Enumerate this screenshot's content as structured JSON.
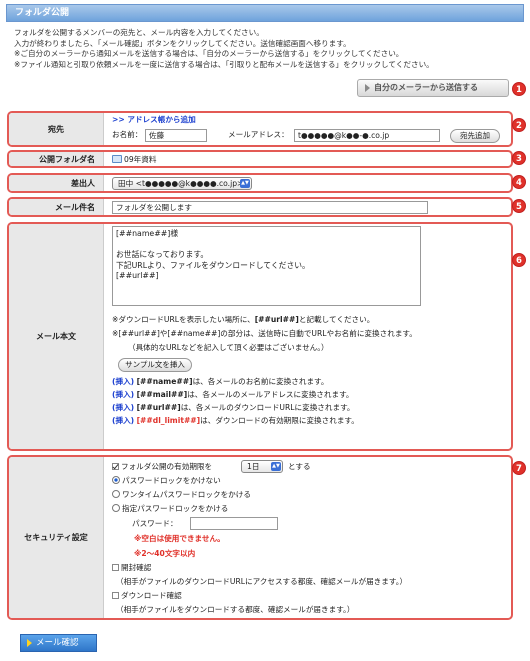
{
  "header": {
    "title": "フォルダ公開"
  },
  "intro": [
    "フォルダを公開するメンバーの宛先と、メール内容を入力してください。",
    "入力が終わりましたら、「メール確認」ボタンをクリックしてください。送信確認画面へ移ります。",
    "※ご自分のメーラーから通知メールを送信する場合は、「自分のメーラーから送信する」をクリックしてください。",
    "※ファイル通知と引取り依頼メールを一度に送信する場合は、「引取りと配布メールを送信する」をクリックしてください。"
  ],
  "own_mailer_button": "自分のメーラーから送信する",
  "badges": [
    "1",
    "2",
    "3",
    "4",
    "5",
    "6",
    "7"
  ],
  "recipient": {
    "label": "宛先",
    "address_book_link": ">> アドレス帳から追加",
    "name_label": "お名前：",
    "name_value": "佐藤",
    "email_label": "メールアドレス：",
    "email_value": "t●●●●●@k●●-●.co.jp",
    "add_button": "宛先追加"
  },
  "folder": {
    "label": "公開フォルダ名",
    "value": "09年資料"
  },
  "sender": {
    "label": "差出人",
    "value": "田中 <t●●●●●@k●●●●.co.jp>"
  },
  "subject": {
    "label": "メール件名",
    "value": "フォルダを公開します"
  },
  "body": {
    "label": "メール本文",
    "text": "[##name##]様\n\nお世話になっております。\n下記URLより、ファイルをダウンロードしてください。\n[##url##]",
    "note1_pre": "※ダウンロードURLを表示したい場所に、",
    "note1_tag": "[##url##]",
    "note1_post": "と記載してください。",
    "note2": "※[##url##]や[##name##]の部分は、送信時に自動でURLやお名前に変換されます。",
    "note3": "（具体的なURLなどを記入して頂く必要はございません。）",
    "sample_button": "サンプル文を挿入",
    "inserts": [
      {
        "link": "(挿入)",
        "tag": "[##name##]",
        "desc": "は、各メールのお名前に変換されます。",
        "red": false
      },
      {
        "link": "(挿入)",
        "tag": "[##mail##]",
        "desc": "は、各メールのメールアドレスに変換されます。",
        "red": false
      },
      {
        "link": "(挿入)",
        "tag": "[##url##]",
        "desc": "は、各メールのダウンロードURLに変換されます。",
        "red": false
      },
      {
        "link": "(挿入)",
        "tag": "[##dl_limit##]",
        "desc": "は、ダウンロードの有効期限に変換されます。",
        "red": true
      }
    ]
  },
  "security": {
    "label": "セキュリティ設定",
    "expiry_pre": "フォルダ公開の有効期限を",
    "expiry_value": "1日",
    "expiry_post": "とする",
    "opt_none": "パスワードロックをかけない",
    "opt_onetime": "ワンタイムパスワードロックをかける",
    "opt_fixed": "指定パスワードロックをかける",
    "password_label": "パスワード：",
    "password_value": "",
    "warn1": "※空白は使用できません。",
    "warn2": "※2～40文字以内",
    "open_confirm": "開封確認",
    "open_confirm_note": "（相手がファイルのダウンロードURLにアクセスする都度、確認メールが届きます。）",
    "dl_confirm": "ダウンロード確認",
    "dl_confirm_note": "（相手がファイルをダウンロードする都度、確認メールが届きます。）"
  },
  "confirm_button": "メール確認",
  "colors": {
    "accent": "#e35a55",
    "header": "#6fa3dc",
    "link": "#1b3fcf",
    "warn": "#e0312a"
  }
}
